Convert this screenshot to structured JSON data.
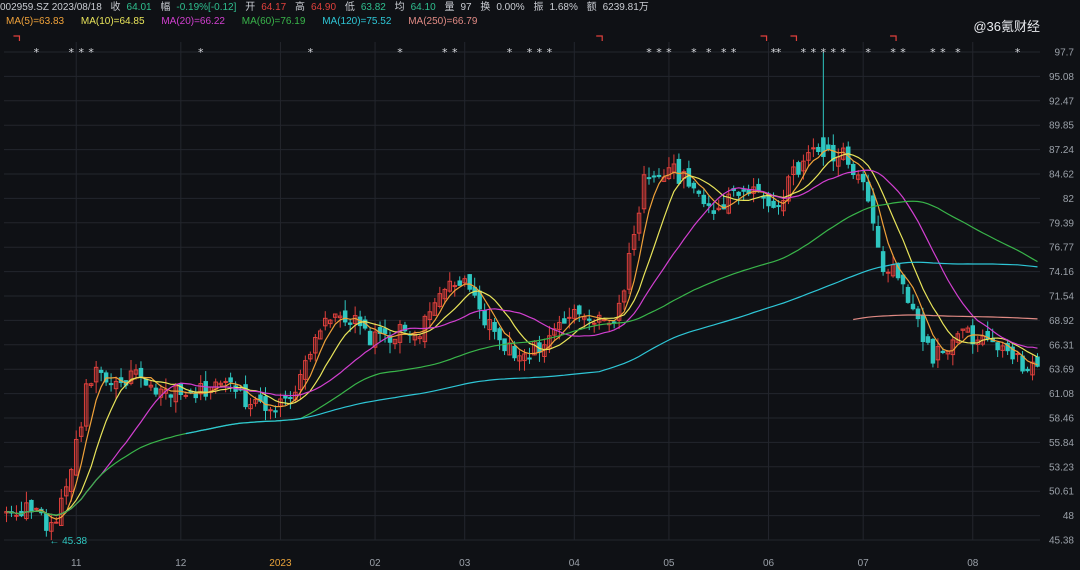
{
  "header": {
    "code_date": "002959.SZ 2023/08/18",
    "close_label": "收",
    "close": "64.01",
    "change_label": "幅",
    "change": "-0.19%[-0.12]",
    "open_label": "开",
    "open": "64.17",
    "high_label": "高",
    "high": "64.90",
    "low_label": "低",
    "low": "63.82",
    "avg_label": "均",
    "avg": "64.10",
    "volume_label": "量",
    "volume": "97",
    "turnover_label": "换",
    "turnover": "0.00%",
    "amplitude_label": "振",
    "amplitude": "1.68%",
    "amount_label": "额",
    "amount": "6239.81万"
  },
  "ma_legend": [
    {
      "label": "MA(5)=63.83",
      "color": "#f0a23a"
    },
    {
      "label": "MA(10)=64.85",
      "color": "#e8e45a"
    },
    {
      "label": "MA(20)=66.22",
      "color": "#d23fd0"
    },
    {
      "label": "MA(60)=76.19",
      "color": "#39b54a"
    },
    {
      "label": "MA(120)=75.52",
      "color": "#2ec6d6"
    },
    {
      "label": "MA(250)=66.79",
      "color": "#e08a84"
    }
  ],
  "watermark": "@36氪财经",
  "colors": {
    "up": "#e0403c",
    "down": "#2ec6c0",
    "grid": "#23262d",
    "axis_text": "#9aa0a8",
    "year_label": "#e8a23a"
  },
  "chart_data": {
    "type": "candlestick",
    "y_ticks": [
      "97.7",
      "95.08",
      "92.47",
      "89.85",
      "87.24",
      "84.62",
      "82",
      "79.39",
      "76.77",
      "74.16",
      "71.54",
      "68.92",
      "66.31",
      "63.69",
      "61.08",
      "58.46",
      "55.84",
      "53.23",
      "50.61",
      "48",
      "45.38"
    ],
    "ylim": [
      45.38,
      97.7
    ],
    "x_ticks": [
      {
        "label": "11",
        "i": 14
      },
      {
        "label": "12",
        "i": 35
      },
      {
        "label": "2023",
        "i": 55,
        "year": true
      },
      {
        "label": "02",
        "i": 74
      },
      {
        "label": "03",
        "i": 92
      },
      {
        "label": "04",
        "i": 114
      },
      {
        "label": "05",
        "i": 133
      },
      {
        "label": "06",
        "i": 153
      },
      {
        "label": "07",
        "i": 172
      },
      {
        "label": "08",
        "i": 194
      }
    ],
    "n": 208,
    "low_marker": {
      "label": "← 45.38",
      "i": 9,
      "value": 45.38
    },
    "waypoints": [
      [
        0,
        48
      ],
      [
        3,
        48.8
      ],
      [
        6,
        48.5
      ],
      [
        9,
        46.5
      ],
      [
        11,
        49
      ],
      [
        13,
        53.5
      ],
      [
        15,
        58
      ],
      [
        16,
        62
      ],
      [
        18,
        63.5
      ],
      [
        20,
        63
      ],
      [
        22,
        61.5
      ],
      [
        24,
        62.8
      ],
      [
        26,
        63.3
      ],
      [
        28,
        61.5
      ],
      [
        30,
        60.8
      ],
      [
        32,
        61.5
      ],
      [
        34,
        61
      ],
      [
        36,
        60.5
      ],
      [
        38,
        61
      ],
      [
        40,
        61.6
      ],
      [
        42,
        62.5
      ],
      [
        44,
        62
      ],
      [
        46,
        61.5
      ],
      [
        48,
        60.5
      ],
      [
        50,
        60.3
      ],
      [
        52,
        60
      ],
      [
        54,
        60
      ],
      [
        56,
        59.8
      ],
      [
        58,
        62
      ],
      [
        60,
        64.5
      ],
      [
        62,
        67.5
      ],
      [
        64,
        69.5
      ],
      [
        66,
        69
      ],
      [
        68,
        68.3
      ],
      [
        70,
        68.7
      ],
      [
        72,
        67.5
      ],
      [
        74,
        66.8
      ],
      [
        76,
        67.5
      ],
      [
        78,
        67.2
      ],
      [
        80,
        68
      ],
      [
        82,
        67.5
      ],
      [
        84,
        68.5
      ],
      [
        86,
        70.5
      ],
      [
        88,
        72.5
      ],
      [
        90,
        73.2
      ],
      [
        92,
        72.5
      ],
      [
        94,
        71
      ],
      [
        96,
        69
      ],
      [
        98,
        67.5
      ],
      [
        100,
        66.5
      ],
      [
        102,
        65
      ],
      [
        104,
        65.5
      ],
      [
        106,
        66
      ],
      [
        108,
        66.5
      ],
      [
        110,
        67.5
      ],
      [
        112,
        68.5
      ],
      [
        114,
        69.3
      ],
      [
        116,
        69.5
      ],
      [
        118,
        69
      ],
      [
        120,
        69.8
      ],
      [
        122,
        68.7
      ],
      [
        124,
        72
      ],
      [
        126,
        78.5
      ],
      [
        128,
        84
      ],
      [
        130,
        85
      ],
      [
        132,
        84.5
      ],
      [
        134,
        85
      ],
      [
        136,
        84
      ],
      [
        138,
        82.5
      ],
      [
        140,
        81.5
      ],
      [
        142,
        81
      ],
      [
        144,
        81.5
      ],
      [
        146,
        82.3
      ],
      [
        148,
        83.5
      ],
      [
        150,
        83
      ],
      [
        152,
        82
      ],
      [
        154,
        81.5
      ],
      [
        156,
        82.5
      ],
      [
        158,
        84.5
      ],
      [
        160,
        86
      ],
      [
        162,
        87.5
      ],
      [
        164,
        87
      ],
      [
        166,
        86.5
      ],
      [
        168,
        86.8
      ],
      [
        170,
        85
      ],
      [
        172,
        83.5
      ],
      [
        174,
        79
      ],
      [
        176,
        74.5
      ],
      [
        178,
        74
      ],
      [
        180,
        72.5
      ],
      [
        182,
        70.5
      ],
      [
        184,
        67
      ],
      [
        186,
        65.2
      ],
      [
        188,
        65.5
      ],
      [
        190,
        66.5
      ],
      [
        192,
        67.5
      ],
      [
        194,
        67
      ],
      [
        196,
        66.8
      ],
      [
        198,
        66.3
      ],
      [
        200,
        65.5
      ],
      [
        202,
        64.8
      ],
      [
        204,
        64.2
      ],
      [
        206,
        63.9
      ],
      [
        207,
        64.01
      ]
    ],
    "ma60_start": 120,
    "ma120_start": 170,
    "ma250_start": 800
  }
}
